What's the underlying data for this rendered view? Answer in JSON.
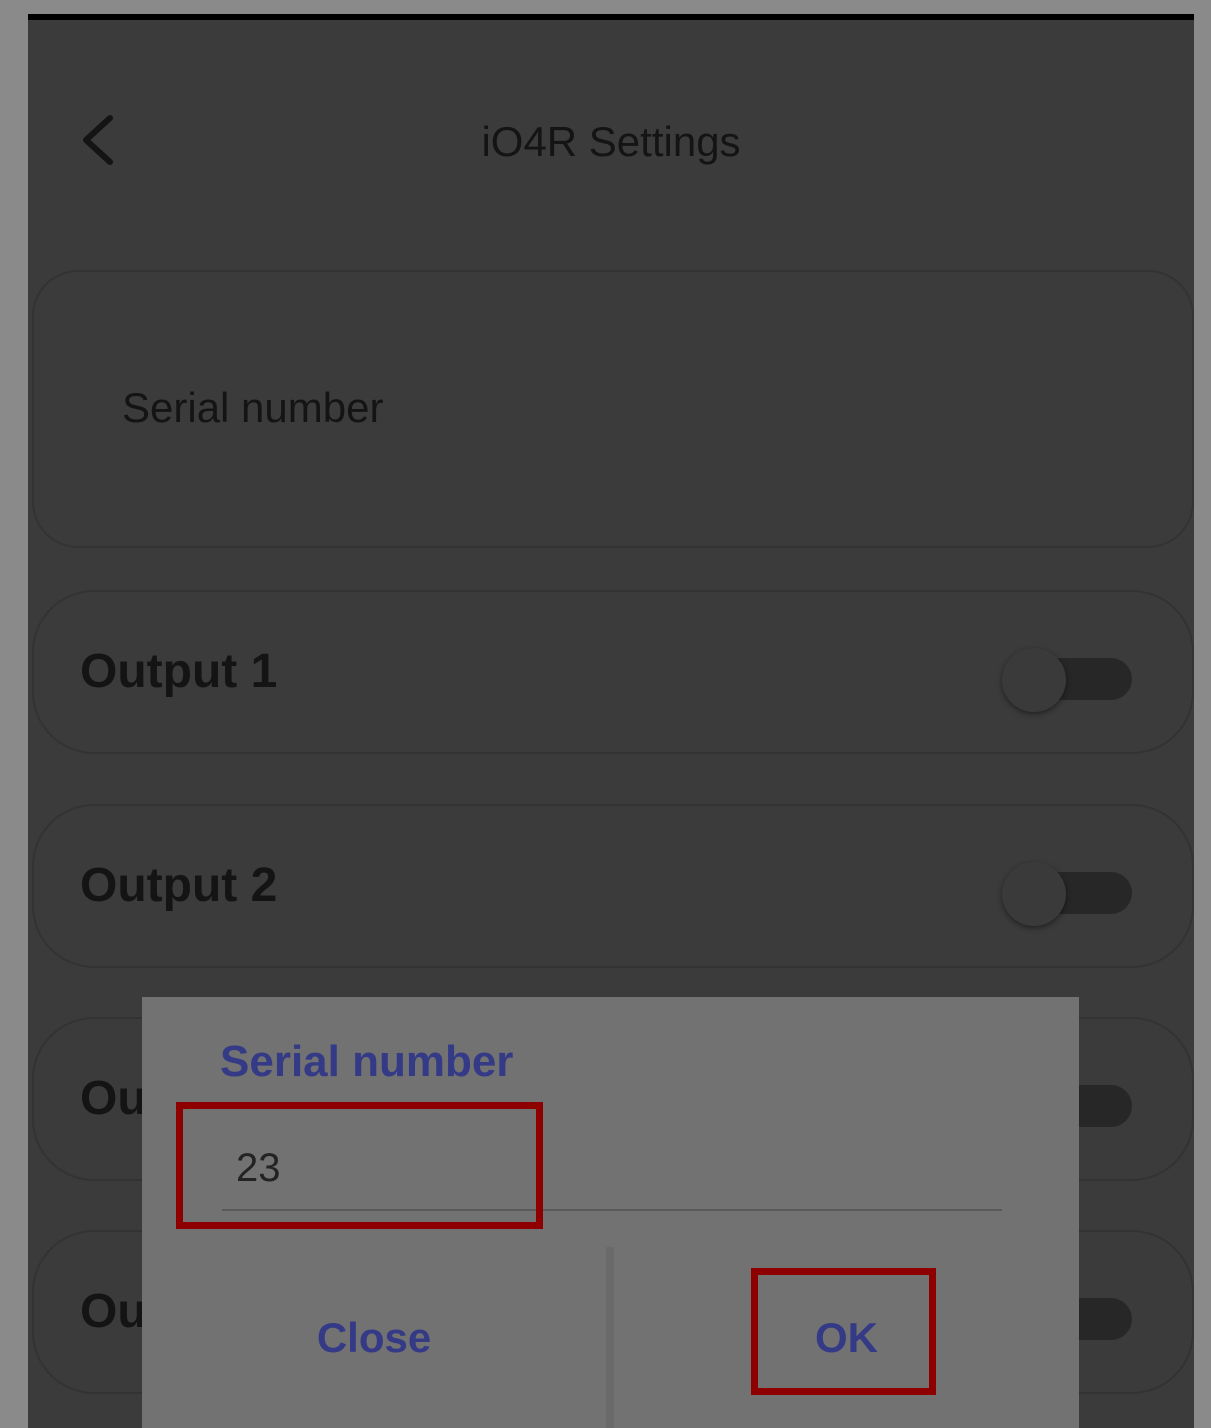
{
  "header": {
    "title": "iO4R Settings",
    "back_icon": "chevron-left-icon"
  },
  "serial_card": {
    "label": "Serial number"
  },
  "outputs": [
    {
      "label": "Output 1",
      "enabled": false
    },
    {
      "label": "Output 2",
      "enabled": false
    },
    {
      "label": "Ou",
      "enabled": false
    },
    {
      "label": "Ou",
      "enabled": false
    }
  ],
  "dialog": {
    "title": "Serial number",
    "input_value": "23",
    "close_label": "Close",
    "ok_label": "OK"
  },
  "colors": {
    "accent": "#343a86",
    "highlight": "#8e0000",
    "overlay": "#3b3b3b"
  }
}
